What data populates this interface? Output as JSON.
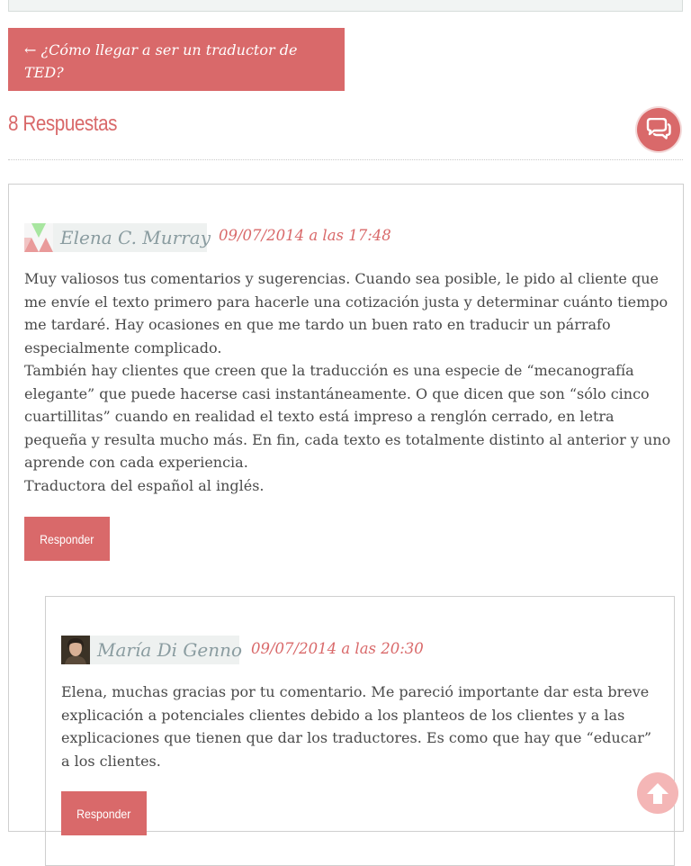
{
  "navigation": {
    "prev_post_label": "← ¿Cómo llegar a ser un traductor de TED?"
  },
  "comments_header": {
    "title": "8 Respuestas",
    "chat_icon": "chat-bubbles-icon"
  },
  "comments": [
    {
      "author": "Elena C. Murray",
      "date": "09/07/2014 a las 17:48",
      "paragraphs": [
        "Muy valiosos tus comentarios y sugerencias. Cuando sea posible, le pido al cliente que me envíe el texto primero para hacerle una cotización justa y determinar cuánto tiempo me tardaré. Hay ocasiones en que me tardo un buen rato en traducir un párrafo especialmente complicado.",
        "También hay clientes que creen que la traducción es una especie de “mecanografía elegante” que puede hacerse casi instantáneamente. O que dicen que son “sólo cinco cuartillitas” cuando en realidad el texto está impreso a renglón cerrado, en letra pequeña y resulta mucho más. En fin, cada texto es totalmente distinto al anterior y uno aprende con cada experiencia.",
        "Traductora del español al inglés."
      ],
      "reply_label": "Responder"
    },
    {
      "author": "María Di Genno",
      "date": "09/07/2014 a las 20:30",
      "paragraphs": [
        "Elena, muchas gracias por tu comentario. Me pareció importante dar esta breve explicación a potenciales clientes debido a los planteos de los clientes y a las explicaciones que tienen que dar los traductores. Es como que hay que “educar” a los clientes."
      ],
      "reply_label": "Responder"
    }
  ],
  "colors": {
    "accent": "#d9696a",
    "author_bg": "#eef1f0",
    "author_text": "#8a9ca0",
    "body_text": "#4a4a4a"
  },
  "back_to_top_icon": "arrow-up-icon"
}
